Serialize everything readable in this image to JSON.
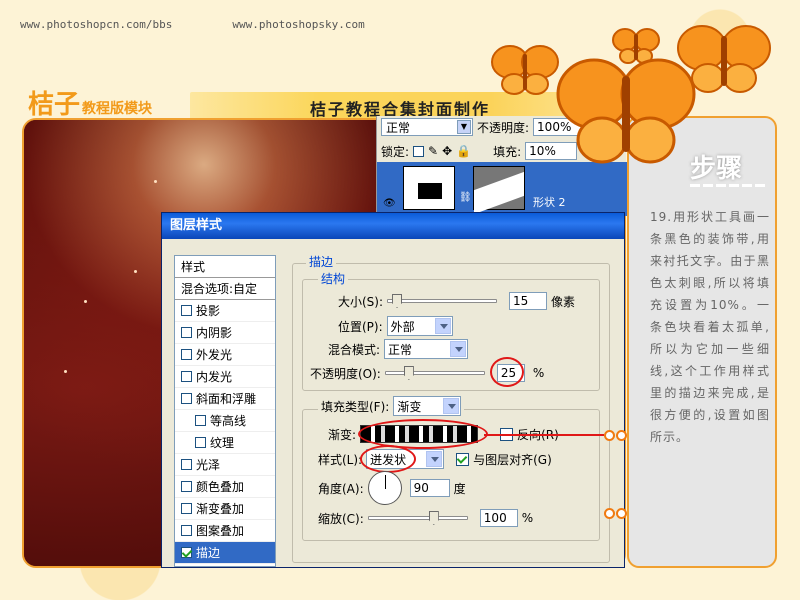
{
  "header": {
    "url_left": "www.photoshopcn.com/bbs",
    "url_right": "www.photoshopsky.com",
    "logo_big": "桔子",
    "logo_small": "教程版模块",
    "title": "桔子教程合集封面制作"
  },
  "layers_panel": {
    "blend_mode": "正常",
    "opacity_label": "不透明度:",
    "opacity_value": "100%",
    "lock_label": "锁定:",
    "fill_label": "填充:",
    "fill_value": "10%",
    "layer_name": "形状 2"
  },
  "dialog": {
    "title": "图层样式",
    "styles_header": "样式",
    "blend_options": "混合选项:自定",
    "styles": [
      {
        "label": "投影",
        "checked": false
      },
      {
        "label": "内阴影",
        "checked": false
      },
      {
        "label": "外发光",
        "checked": false
      },
      {
        "label": "内发光",
        "checked": false
      },
      {
        "label": "斜面和浮雕",
        "checked": false
      },
      {
        "label": "等高线",
        "checked": false
      },
      {
        "label": "纹理",
        "checked": false
      },
      {
        "label": "光泽",
        "checked": false
      },
      {
        "label": "颜色叠加",
        "checked": false
      },
      {
        "label": "渐变叠加",
        "checked": false
      },
      {
        "label": "图案叠加",
        "checked": false
      },
      {
        "label": "描边",
        "checked": true
      }
    ],
    "stroke_section": "描边",
    "structure_section": "结构",
    "size_label": "大小(S):",
    "size_value": "15",
    "size_unit": "像素",
    "position_label": "位置(P):",
    "position_value": "外部",
    "blend_label": "混合模式:",
    "blend_value": "正常",
    "opacity_label": "不透明度(O):",
    "opacity_value": "25",
    "opacity_unit": "%",
    "fill_type_label": "填充类型(F):",
    "fill_type_value": "渐变",
    "gradient_label": "渐变:",
    "reverse_label": "反向(R)",
    "style_label": "样式(L):",
    "style_value": "迸发状",
    "align_label": "与图层对齐(G)",
    "angle_label": "角度(A):",
    "angle_value": "90",
    "angle_unit": "度",
    "scale_label": "缩放(C):",
    "scale_value": "100",
    "scale_unit": "%"
  },
  "steps": {
    "heading": "步骤",
    "text": "19.用形状工具画一条黑色的装饰带,用来衬托文字。由于黑色太刺眼,所以将填充设置为10%。一条色块看着太孤单,所以为它加一些细线,这个工作用样式里的描边来完成,是很方便的,设置如图所示。"
  },
  "icons": [
    "butterfly-icon",
    "lock-icon",
    "eye-icon",
    "link-icon"
  ],
  "colors": {
    "accent": "#f29a1a",
    "frame": "#f0a030",
    "title_bar": "#0a5bd8",
    "selection": "#316ac5",
    "annotation": "#e01818"
  }
}
